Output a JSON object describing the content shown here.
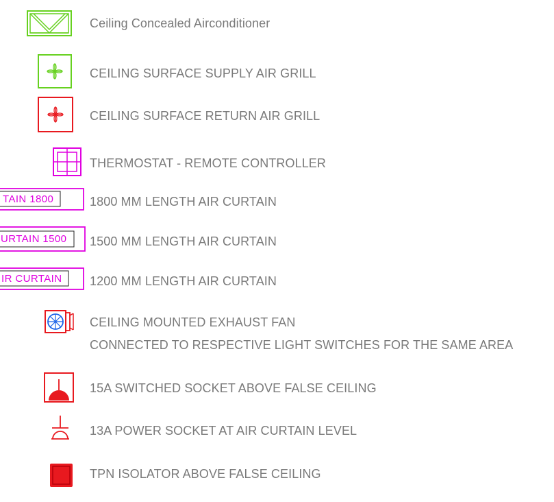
{
  "legend": [
    {
      "symbol": "ceiling-concealed-ac-icon",
      "color": "#66d11f",
      "label": "Ceiling Concealed Airconditioner"
    },
    {
      "symbol": "supply-air-grill-icon",
      "color": "#66d11f",
      "label": "CEILING SURFACE SUPPLY AIR GRILL"
    },
    {
      "symbol": "return-air-grill-icon",
      "color": "#e8191f",
      "label": "CEILING SURFACE RETURN AIR GRILL"
    },
    {
      "symbol": "thermostat-icon",
      "color": "#e000e0",
      "label": "THERMOSTAT - REMOTE CONTROLLER"
    },
    {
      "symbol": "air-curtain-1800-icon",
      "color": "#e000e0",
      "tag": "TAIN  1800",
      "label": "1800 MM LENGTH AIR CURTAIN"
    },
    {
      "symbol": "air-curtain-1500-icon",
      "color": "#e000e0",
      "tag": "URTAIN  1500",
      "label": "1500 MM LENGTH AIR CURTAIN"
    },
    {
      "symbol": "air-curtain-1200-icon",
      "color": "#e000e0",
      "tag": "IR  CURTAIN",
      "label": "1200 MM LENGTH AIR CURTAIN"
    },
    {
      "symbol": "exhaust-fan-icon",
      "color": "#e8191f",
      "label": "CEILING MOUNTED EXHAUST FAN",
      "label2": "CONNECTED TO RESPECTIVE LIGHT SWITCHES FOR THE SAME AREA"
    },
    {
      "symbol": "switched-socket-icon",
      "color": "#e8191f",
      "label": "15A SWITCHED SOCKET ABOVE FALSE CEILING"
    },
    {
      "symbol": "power-socket-icon",
      "color": "#e8191f",
      "label": "13A POWER SOCKET AT AIR CURTAIN LEVEL"
    },
    {
      "symbol": "tpn-isolator-icon",
      "color": "#e8191f",
      "label": "TPN ISOLATOR ABOVE FALSE CEILING"
    }
  ]
}
